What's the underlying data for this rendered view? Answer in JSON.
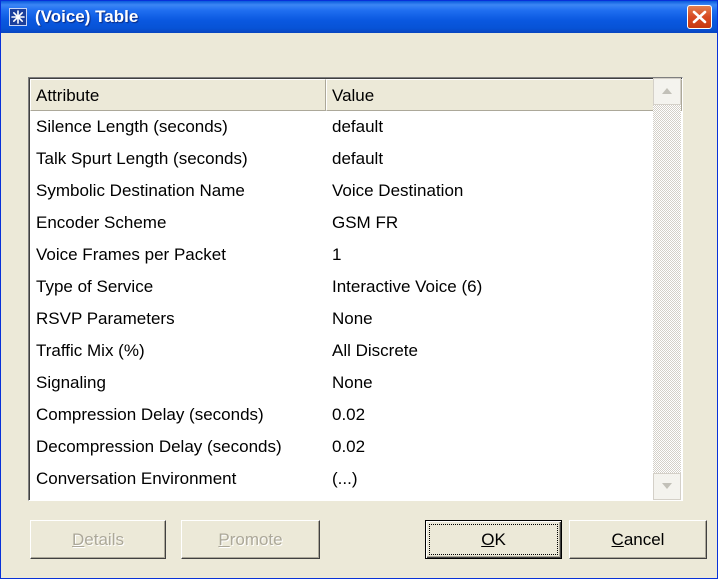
{
  "window": {
    "title": "(Voice) Table",
    "icon": "star-burst-icon",
    "close_icon": "close-x-icon"
  },
  "table": {
    "columns": [
      "Attribute",
      "Value"
    ],
    "rows": [
      {
        "attribute": "Silence Length (seconds)",
        "value": "default"
      },
      {
        "attribute": "Talk Spurt Length (seconds)",
        "value": "default"
      },
      {
        "attribute": "Symbolic Destination Name",
        "value": "Voice Destination"
      },
      {
        "attribute": "Encoder Scheme",
        "value": "GSM FR"
      },
      {
        "attribute": "Voice Frames per Packet",
        "value": "1"
      },
      {
        "attribute": "Type of Service",
        "value": "Interactive Voice (6)"
      },
      {
        "attribute": "RSVP Parameters",
        "value": "None"
      },
      {
        "attribute": "Traffic Mix (%)",
        "value": "All Discrete"
      },
      {
        "attribute": "Signaling",
        "value": "None"
      },
      {
        "attribute": "Compression Delay (seconds)",
        "value": "0.02"
      },
      {
        "attribute": "Decompression Delay (seconds)",
        "value": "0.02"
      },
      {
        "attribute": "Conversation Environment",
        "value": "(...)"
      }
    ]
  },
  "scrollbar": {
    "up_icon": "scroll-up-arrow-icon",
    "down_icon": "scroll-down-arrow-icon"
  },
  "buttons": {
    "details": {
      "mnemonic": "D",
      "rest": "etails",
      "enabled": false
    },
    "promote": {
      "mnemonic": "P",
      "rest": "romote",
      "enabled": false
    },
    "ok": {
      "mnemonic": "O",
      "rest": "K",
      "enabled": true
    },
    "cancel": {
      "mnemonic": "C",
      "rest": "ancel",
      "enabled": true
    }
  },
  "colors": {
    "title_bar": "#0a58e0",
    "close_button": "#d84a22",
    "dialog_face": "#ece9d8",
    "disabled_text": "#aca899"
  }
}
